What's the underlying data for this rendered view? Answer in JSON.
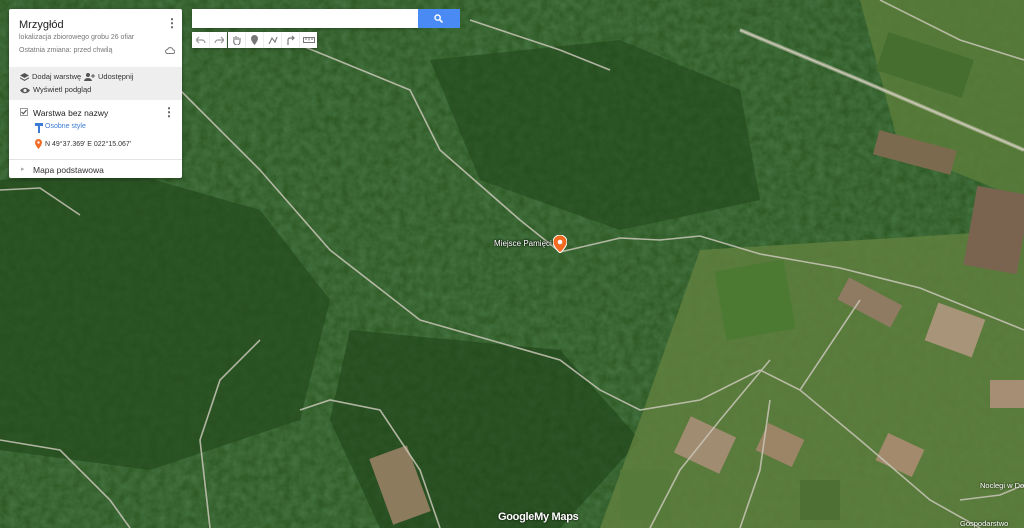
{
  "map": {
    "type": "satellite",
    "accent_color": "#4a8af4",
    "marker_color": "#f26b21",
    "marker_label": "Miejsce Pamięci",
    "poi_labels": [
      "Noclegi w Do",
      "Gospodarstwo"
    ],
    "logo": {
      "google": "Google",
      "mymaps": "My Maps"
    }
  },
  "panel": {
    "title": "Mrzygłód",
    "description": "lokalizacja zbiorowego grobu 26 ofiar",
    "saved_status": "Ostatnia zmiana: przed chwilą",
    "actions": {
      "add_layer": "Dodaj warstwę",
      "share": "Udostępnij",
      "preview": "Wyświetl podgląd"
    },
    "layer": {
      "name": "Warstwa bez nazwy",
      "style_link": "Osobne style",
      "item_coords": "N 49°37.369' E 022°15.067'"
    },
    "base_map": "Mapa podstawowa"
  },
  "search": {
    "value": "",
    "placeholder": ""
  },
  "toolbar": {
    "icons": [
      "undo-icon",
      "redo-icon",
      "hand-icon",
      "marker-icon",
      "line-icon",
      "directions-icon",
      "ruler-icon"
    ]
  }
}
